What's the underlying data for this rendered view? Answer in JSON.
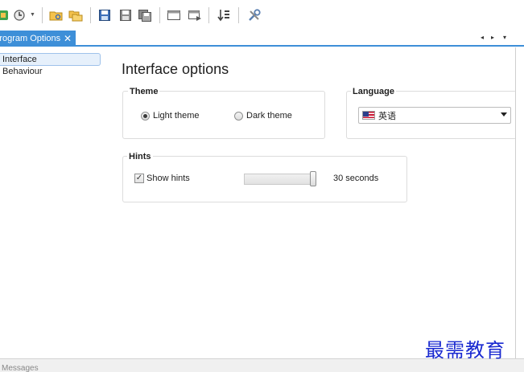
{
  "toolbar": {
    "icons": [
      "app-icon",
      "history-icon",
      "open-folder-icon",
      "copy-folder-icon",
      "save-icon",
      "save-all-icon",
      "save-copy-icon",
      "window-icon",
      "window-arrow-icon",
      "sort-icon",
      "tools-icon"
    ]
  },
  "tab": {
    "label": "Program Options",
    "close_glyph": "✕",
    "nav_prev": "◂",
    "nav_next": "▸",
    "nav_menu": "▾"
  },
  "nav": {
    "items": [
      {
        "label": "Interface",
        "selected": true
      },
      {
        "label": "Behaviour",
        "selected": false
      }
    ]
  },
  "page": {
    "title": "Interface options"
  },
  "theme": {
    "title": "Theme",
    "options": [
      {
        "label": "Light theme",
        "checked": true
      },
      {
        "label": "Dark theme",
        "checked": false
      }
    ]
  },
  "language": {
    "title": "Language",
    "selected": "英语",
    "flag": "us-flag-icon"
  },
  "hints": {
    "title": "Hints",
    "checkbox_label": "Show hints",
    "checked": true,
    "slider_level_fraction": 1.0,
    "value_label": "30 seconds"
  },
  "status": {
    "messages_label": "Messages"
  },
  "watermark": {
    "text": "最需教育"
  },
  "colors": {
    "accent": "#3d8fd8",
    "watermark": "#1a2ad0"
  }
}
